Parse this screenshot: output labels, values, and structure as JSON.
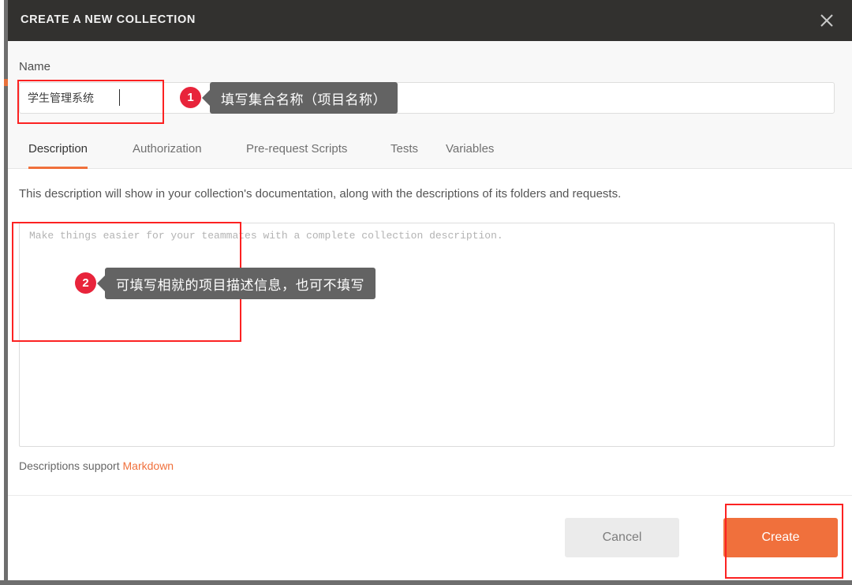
{
  "header": {
    "title": "CREATE A NEW COLLECTION",
    "close_icon": "close-icon"
  },
  "name_section": {
    "label": "Name",
    "value": "学生管理系统",
    "placeholder": ""
  },
  "tabs": [
    {
      "label": "Description",
      "active": true
    },
    {
      "label": "Authorization",
      "active": false
    },
    {
      "label": "Pre-request Scripts",
      "active": false
    },
    {
      "label": "Tests",
      "active": false
    },
    {
      "label": "Variables",
      "active": false
    }
  ],
  "description": {
    "hint": "This description will show in your collection's documentation, along with the descriptions of its folders and requests.",
    "placeholder": "Make things easier for your teammates with a complete collection description.",
    "value": "",
    "markdown_prefix": "Descriptions support ",
    "markdown_link": "Markdown"
  },
  "footer": {
    "cancel_label": "Cancel",
    "create_label": "Create"
  },
  "annotations": [
    {
      "badge": "1",
      "text": "填写集合名称（项目名称）"
    },
    {
      "badge": "2",
      "text": "可填写相就的项目描述信息，也可不填写"
    }
  ],
  "colors": {
    "accent": "#f0703c",
    "annotation": "#fc2222",
    "badge": "#e8243b",
    "callout_bg": "#636363",
    "header_bg": "#32312f"
  }
}
